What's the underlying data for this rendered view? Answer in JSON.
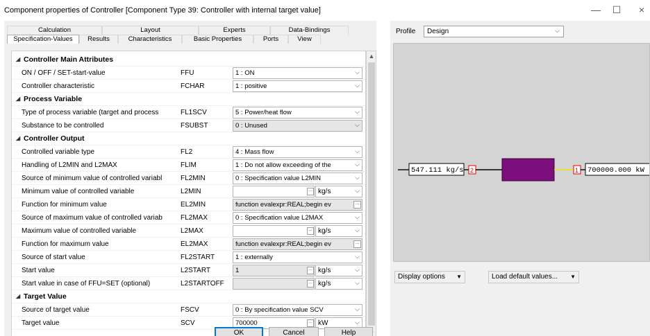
{
  "window": {
    "title": "Component properties of Controller   [Component Type 39: Controller with internal target value]",
    "minimize": "—",
    "maximize": "☐",
    "close": "×"
  },
  "tabs": {
    "top": [
      {
        "label": "Calculation"
      },
      {
        "label": "Layout"
      },
      {
        "label": "Experts"
      },
      {
        "label": "Data-Bindings"
      }
    ],
    "bottom": [
      {
        "label": "Specification-Values"
      },
      {
        "label": "Results"
      },
      {
        "label": "Characteristics"
      },
      {
        "label": "Basic Properties"
      },
      {
        "label": "Ports"
      },
      {
        "label": "View"
      }
    ]
  },
  "grid": {
    "categories": {
      "main": "Controller Main Attributes",
      "process": "Process Variable",
      "output": "Controller Output",
      "target": "Target Value"
    },
    "rows": {
      "ffu": {
        "name": "ON / OFF / SET-start-value",
        "code": "FFU",
        "value": "1 : ON"
      },
      "fchar": {
        "name": "Controller characteristic",
        "code": "FCHAR",
        "value": "1 : positive"
      },
      "fl1scv": {
        "name": "Type of process variable (target and process",
        "code": "FL1SCV",
        "value": "5 : Power/heat flow"
      },
      "fsubst": {
        "name": "Substance to be controlled",
        "code": "FSUBST",
        "value": "0 : Unused"
      },
      "fl2": {
        "name": "Controlled variable type",
        "code": "FL2",
        "value": "4 : Mass flow"
      },
      "flim": {
        "name": "Handling of L2MIN and L2MAX",
        "code": "FLIM",
        "value": "1 : Do not allow exceeding of the"
      },
      "fl2min": {
        "name": "Source of minimum value of controlled variabl",
        "code": "FL2MIN",
        "value": "0 : Specification value L2MIN"
      },
      "l2min": {
        "name": "Minimum value of controlled variable",
        "code": "L2MIN",
        "value": "",
        "unit": "kg/s"
      },
      "el2min": {
        "name": "Function for minimum value",
        "code": "EL2MIN",
        "value": "function evalexpr:REAL;begin   ev"
      },
      "fl2max": {
        "name": "Source of maximum value of controlled variab",
        "code": "FL2MAX",
        "value": "0 : Specification value L2MAX"
      },
      "l2max": {
        "name": "Maximum value of controlled variable",
        "code": "L2MAX",
        "value": "",
        "unit": "kg/s"
      },
      "el2max": {
        "name": "Function for maximum value",
        "code": "EL2MAX",
        "value": "function evalexpr:REAL;begin   ev"
      },
      "fl2start": {
        "name": "Source of start value",
        "code": "FL2START",
        "value": "1 : externally"
      },
      "l2start": {
        "name": "Start value",
        "code": "L2START",
        "value": "1",
        "unit": "kg/s"
      },
      "l2startoff": {
        "name": "Start value in case of FFU=SET (optional)",
        "code": "L2STARTOFF",
        "value": "",
        "unit": "kg/s"
      },
      "fscv": {
        "name": "Source of target value",
        "code": "FSCV",
        "value": "0 : By specification value SCV"
      },
      "scv": {
        "name": "Target value",
        "code": "SCV",
        "value": "700000",
        "unit": "kW"
      }
    },
    "dots": "...",
    "dropdown_glyph": "⌵"
  },
  "buttons": {
    "ok": "OK",
    "cancel": "Cancel",
    "help": "Help"
  },
  "profile": {
    "label": "Profile",
    "value": "Design"
  },
  "canvas": {
    "left_value": "547.111 kg/s",
    "left_port": "2",
    "right_port": "1",
    "right_value": "700000.000 kW",
    "component_color": "#7b0f7b",
    "signal_color": "#e6e600"
  },
  "bottom_buttons": {
    "display_options": "Display options",
    "load_defaults": "Load default values..."
  }
}
